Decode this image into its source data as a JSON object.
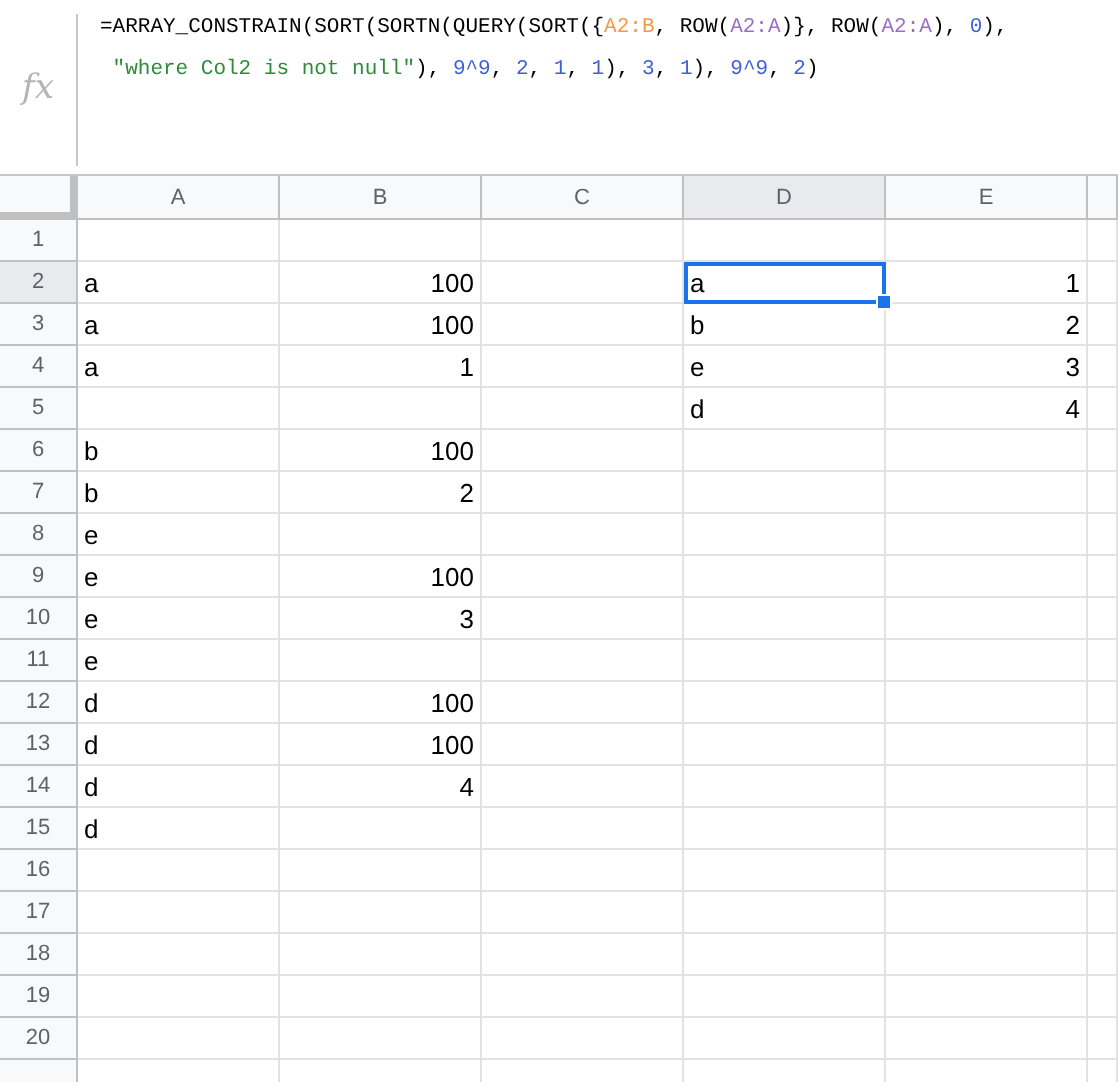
{
  "formula_bar": {
    "icon_label": "fx",
    "lines": [
      [
        {
          "text": "=ARRAY_CONSTRAIN(SORT(SORTN(QUERY(SORT({",
          "color": "#000000"
        },
        {
          "text": "A2:B",
          "color": "#f09a4e"
        },
        {
          "text": ", ROW(",
          "color": "#000000"
        },
        {
          "text": "A2:A",
          "color": "#9a6fc4"
        },
        {
          "text": ")}, ROW(",
          "color": "#000000"
        },
        {
          "text": "A2:A",
          "color": "#9a6fc4"
        },
        {
          "text": "), ",
          "color": "#000000"
        },
        {
          "text": "0",
          "color": "#3f5fd8"
        },
        {
          "text": "),",
          "color": "#000000"
        }
      ],
      [
        {
          "text": " \"where Col2 is not null\"",
          "color": "#2f8a3a"
        },
        {
          "text": "), ",
          "color": "#000000"
        },
        {
          "text": "9^9",
          "color": "#3f5fd8"
        },
        {
          "text": ", ",
          "color": "#000000"
        },
        {
          "text": "2",
          "color": "#3f5fd8"
        },
        {
          "text": ", ",
          "color": "#000000"
        },
        {
          "text": "1",
          "color": "#3f5fd8"
        },
        {
          "text": ", ",
          "color": "#000000"
        },
        {
          "text": "1",
          "color": "#3f5fd8"
        },
        {
          "text": "), ",
          "color": "#000000"
        },
        {
          "text": "3",
          "color": "#3f5fd8"
        },
        {
          "text": ", ",
          "color": "#000000"
        },
        {
          "text": "1",
          "color": "#3f5fd8"
        },
        {
          "text": "), ",
          "color": "#000000"
        },
        {
          "text": "9^9",
          "color": "#3f5fd8"
        },
        {
          "text": ", ",
          "color": "#000000"
        },
        {
          "text": "2",
          "color": "#3f5fd8"
        },
        {
          "text": ")",
          "color": "#000000"
        }
      ]
    ]
  },
  "columns": [
    {
      "label": "A",
      "selected": false
    },
    {
      "label": "B",
      "selected": false
    },
    {
      "label": "C",
      "selected": false
    },
    {
      "label": "D",
      "selected": true
    },
    {
      "label": "E",
      "selected": false
    }
  ],
  "rows": [
    {
      "number": "1",
      "selected": false,
      "cells": [
        null,
        null,
        null,
        null,
        null
      ]
    },
    {
      "number": "2",
      "selected": true,
      "cells": [
        {
          "text": "a",
          "kind": "text",
          "selected": false
        },
        {
          "text": "100",
          "kind": "number",
          "selected": false
        },
        null,
        {
          "text": "a",
          "kind": "text",
          "selected": true
        },
        {
          "text": "1",
          "kind": "number",
          "selected": false
        }
      ]
    },
    {
      "number": "3",
      "selected": false,
      "cells": [
        {
          "text": "a",
          "kind": "text",
          "selected": false
        },
        {
          "text": "100",
          "kind": "number",
          "selected": false
        },
        null,
        {
          "text": "b",
          "kind": "text",
          "selected": false
        },
        {
          "text": "2",
          "kind": "number",
          "selected": false
        }
      ]
    },
    {
      "number": "4",
      "selected": false,
      "cells": [
        {
          "text": "a",
          "kind": "text",
          "selected": false
        },
        {
          "text": "1",
          "kind": "number",
          "selected": false
        },
        null,
        {
          "text": "e",
          "kind": "text",
          "selected": false
        },
        {
          "text": "3",
          "kind": "number",
          "selected": false
        }
      ]
    },
    {
      "number": "5",
      "selected": false,
      "cells": [
        null,
        null,
        null,
        {
          "text": "d",
          "kind": "text",
          "selected": false
        },
        {
          "text": "4",
          "kind": "number",
          "selected": false
        }
      ]
    },
    {
      "number": "6",
      "selected": false,
      "cells": [
        {
          "text": "b",
          "kind": "text",
          "selected": false
        },
        {
          "text": "100",
          "kind": "number",
          "selected": false
        },
        null,
        null,
        null
      ]
    },
    {
      "number": "7",
      "selected": false,
      "cells": [
        {
          "text": "b",
          "kind": "text",
          "selected": false
        },
        {
          "text": "2",
          "kind": "number",
          "selected": false
        },
        null,
        null,
        null
      ]
    },
    {
      "number": "8",
      "selected": false,
      "cells": [
        {
          "text": "e",
          "kind": "text",
          "selected": false
        },
        null,
        null,
        null,
        null
      ]
    },
    {
      "number": "9",
      "selected": false,
      "cells": [
        {
          "text": "e",
          "kind": "text",
          "selected": false
        },
        {
          "text": "100",
          "kind": "number",
          "selected": false
        },
        null,
        null,
        null
      ]
    },
    {
      "number": "10",
      "selected": false,
      "cells": [
        {
          "text": "e",
          "kind": "text",
          "selected": false
        },
        {
          "text": "3",
          "kind": "number",
          "selected": false
        },
        null,
        null,
        null
      ]
    },
    {
      "number": "11",
      "selected": false,
      "cells": [
        {
          "text": "e",
          "kind": "text",
          "selected": false
        },
        null,
        null,
        null,
        null
      ]
    },
    {
      "number": "12",
      "selected": false,
      "cells": [
        {
          "text": "d",
          "kind": "text",
          "selected": false
        },
        {
          "text": "100",
          "kind": "number",
          "selected": false
        },
        null,
        null,
        null
      ]
    },
    {
      "number": "13",
      "selected": false,
      "cells": [
        {
          "text": "d",
          "kind": "text",
          "selected": false
        },
        {
          "text": "100",
          "kind": "number",
          "selected": false
        },
        null,
        null,
        null
      ]
    },
    {
      "number": "14",
      "selected": false,
      "cells": [
        {
          "text": "d",
          "kind": "text",
          "selected": false
        },
        {
          "text": "4",
          "kind": "number",
          "selected": false
        },
        null,
        null,
        null
      ]
    },
    {
      "number": "15",
      "selected": false,
      "cells": [
        {
          "text": "d",
          "kind": "text",
          "selected": false
        },
        null,
        null,
        null,
        null
      ]
    },
    {
      "number": "16",
      "selected": false,
      "cells": [
        null,
        null,
        null,
        null,
        null
      ]
    },
    {
      "number": "17",
      "selected": false,
      "cells": [
        null,
        null,
        null,
        null,
        null
      ]
    },
    {
      "number": "18",
      "selected": false,
      "cells": [
        null,
        null,
        null,
        null,
        null
      ]
    },
    {
      "number": "19",
      "selected": false,
      "cells": [
        null,
        null,
        null,
        null,
        null
      ]
    },
    {
      "number": "20",
      "selected": false,
      "cells": [
        null,
        null,
        null,
        null,
        null
      ]
    }
  ]
}
